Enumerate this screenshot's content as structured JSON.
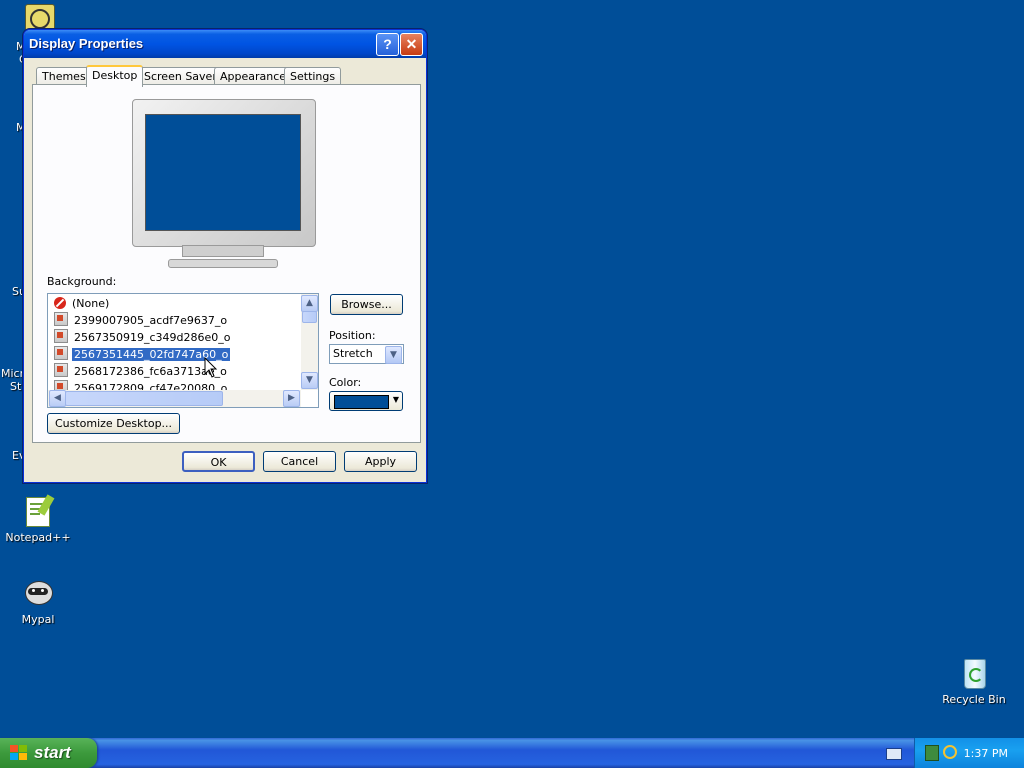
{
  "desktop": {
    "icons": [
      {
        "label": "Notepad++"
      },
      {
        "label": "Mypal"
      },
      {
        "label": "Recycle Bin"
      }
    ],
    "clipped_labels": [
      "M",
      "C",
      "M",
      "Su",
      "Micro",
      "Stu",
      "Ev"
    ]
  },
  "window": {
    "title": "Display Properties",
    "help_button": "?",
    "close_button": "✕",
    "tabs": [
      {
        "label": "Themes",
        "active": false
      },
      {
        "label": "Desktop",
        "active": true
      },
      {
        "label": "Screen Saver",
        "active": false
      },
      {
        "label": "Appearance",
        "active": false
      },
      {
        "label": "Settings",
        "active": false
      }
    ],
    "background_label": "Background:",
    "background_items": [
      {
        "label": "(None)",
        "icon": "none-icon",
        "selected": false
      },
      {
        "label": "2399007905_acdf7e9637_o",
        "icon": "image-file-icon",
        "selected": false
      },
      {
        "label": "2567350919_c349d286e0_o",
        "icon": "image-file-icon",
        "selected": false
      },
      {
        "label": "2567351445_02fd747a60_o",
        "icon": "image-file-icon",
        "selected": true
      },
      {
        "label": "2568172386_fc6a3713ae_o",
        "icon": "image-file-icon",
        "selected": false
      },
      {
        "label": "2569172809_cf47e20080_o",
        "icon": "image-file-icon",
        "selected": false
      }
    ],
    "browse_button": "Browse...",
    "position_label": "Position:",
    "position_value": "Stretch",
    "color_label": "Color:",
    "color_value": "#004e98",
    "customize_button": "Customize Desktop...",
    "ok_button": "OK",
    "cancel_button": "Cancel",
    "apply_button": "Apply"
  },
  "taskbar": {
    "start_label": "start",
    "clock": "1:37 PM"
  }
}
